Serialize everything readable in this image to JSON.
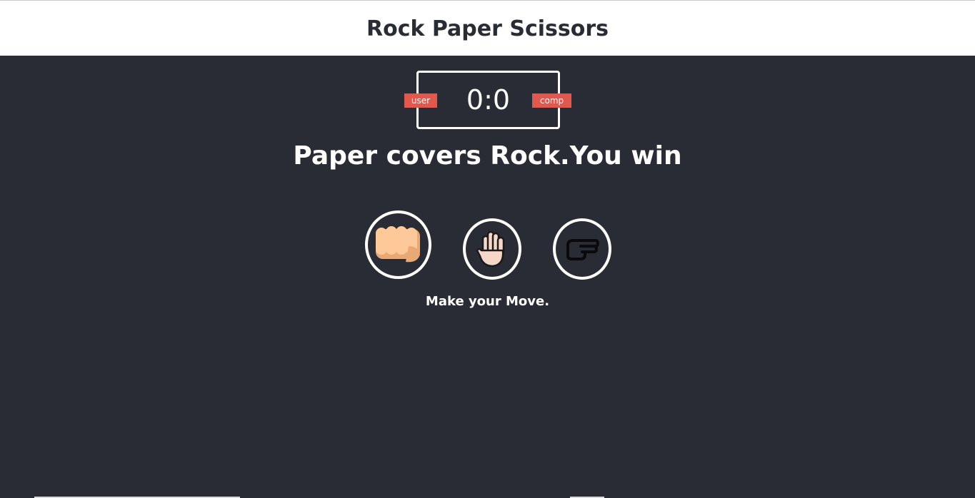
{
  "header": {
    "title": "Rock Paper Scissors"
  },
  "scoreboard": {
    "score": "0:0",
    "user_label": "user",
    "comp_label": "comp",
    "badge_color": "#e2584d"
  },
  "result_text": "Paper covers Rock.You win",
  "choices": [
    {
      "name": "rock",
      "icon": "fist-icon"
    },
    {
      "name": "paper",
      "icon": "raised-hand-icon"
    },
    {
      "name": "scissors",
      "icon": "pointing-hand-icon"
    }
  ],
  "action_message": "Make your Move.",
  "colors": {
    "background": "#2a2c35",
    "header_background": "#ffffff",
    "text": "#ffffff"
  }
}
